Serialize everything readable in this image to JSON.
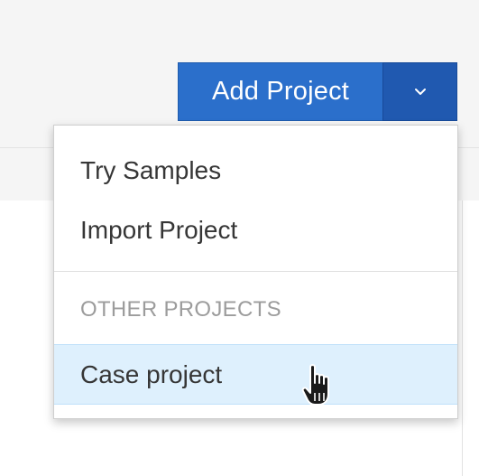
{
  "toolbar": {
    "add_project_label": "Add Project",
    "toggle_icon": "chevron-down-icon"
  },
  "dropdown": {
    "items": [
      {
        "label": "Try Samples"
      },
      {
        "label": "Import Project"
      }
    ],
    "section_header": "OTHER PROJECTS",
    "projects": [
      {
        "label": "Case project",
        "highlighted": true
      }
    ]
  },
  "cursor": {
    "icon": "hand-pointer-icon"
  },
  "colors": {
    "primary": "#2b6fcb",
    "primary_dark": "#2059b0",
    "hover_bg": "#def0fd",
    "header_bg": "#f5f5f5"
  }
}
